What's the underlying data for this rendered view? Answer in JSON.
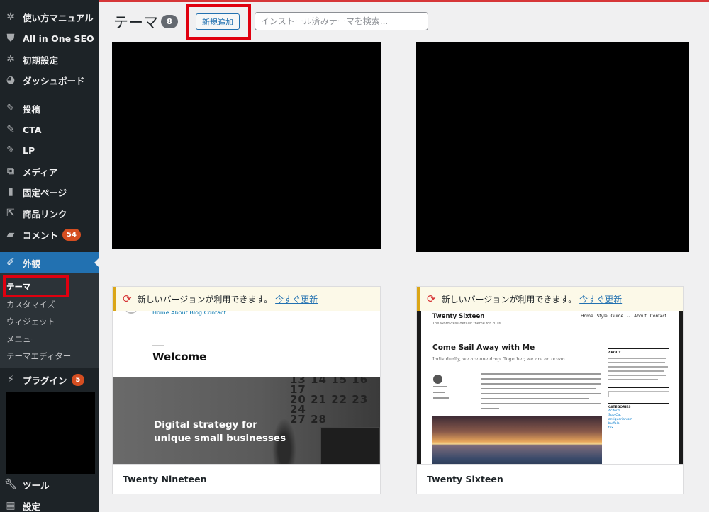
{
  "sidebar": {
    "items": [
      {
        "label": "使い方マニュアル",
        "icon": "gear-icon"
      },
      {
        "label": "All in One SEO",
        "icon": "shield-icon"
      },
      {
        "label": "初期設定",
        "icon": "gear-icon"
      },
      {
        "label": "ダッシュボード",
        "icon": "dashboard-icon"
      },
      {
        "label": "投稿",
        "icon": "pin-icon"
      },
      {
        "label": "CTA",
        "icon": "pin-icon"
      },
      {
        "label": "LP",
        "icon": "pin-icon"
      },
      {
        "label": "メディア",
        "icon": "media-icon"
      },
      {
        "label": "固定ページ",
        "icon": "page-icon"
      },
      {
        "label": "商品リンク",
        "icon": "link-icon"
      },
      {
        "label": "コメント",
        "icon": "comment-icon",
        "badge": "54"
      },
      {
        "label": "外観",
        "icon": "brush-icon"
      },
      {
        "label": "プラグイン",
        "icon": "plugin-icon",
        "badge": "5"
      },
      {
        "label": "ツール",
        "icon": "wrench-icon"
      },
      {
        "label": "設定",
        "icon": "settings-icon"
      }
    ],
    "appearance_submenu": [
      "テーマ",
      "カスタマイズ",
      "ウィジェット",
      "メニュー",
      "テーマエディター"
    ]
  },
  "header": {
    "title": "テーマ",
    "count": "8",
    "add_new_label": "新規追加",
    "search_placeholder": "インストール済みテーマを検索..."
  },
  "themes": [
    {
      "name": "Twenty Nineteen",
      "update_text": "新しいバージョンが利用できます。",
      "update_link": "今すぐ更新",
      "preview": {
        "nav": "Home  About  Blog  Contact",
        "welcome": "Welcome",
        "headline_1": "Digital strategy for",
        "headline_2": "unique small businesses",
        "calendar_row_1": "13 14 15 16 17",
        "calendar_row_2": "20 21 22 23 24",
        "calendar_row_3": "27 28"
      }
    },
    {
      "name": "Twenty Sixteen",
      "update_text": "新しいバージョンが利用できます。",
      "update_link": "今すぐ更新",
      "preview": {
        "site_title": "Twenty Sixteen",
        "tagline": "The WordPress default theme for 2016",
        "nav": "Home  Style Guide ⌄  About  Contact",
        "post_title": "Come Sail Away with Me",
        "excerpt": "Individually, we are one drop. Together, we are an ocean.",
        "about_head": "ABOUT",
        "categories_head": "CATEGORIES",
        "categories": [
          "Aciform",
          "Sub-Cat",
          "antiquarianism",
          "buffalo",
          "fex"
        ]
      }
    }
  ],
  "colors": {
    "sidebar_bg": "#1d2327",
    "active_menu": "#2271b1",
    "update_badge": "#d63638",
    "highlight_box": "#e0000f",
    "notice_bg": "#fcf9e8"
  }
}
